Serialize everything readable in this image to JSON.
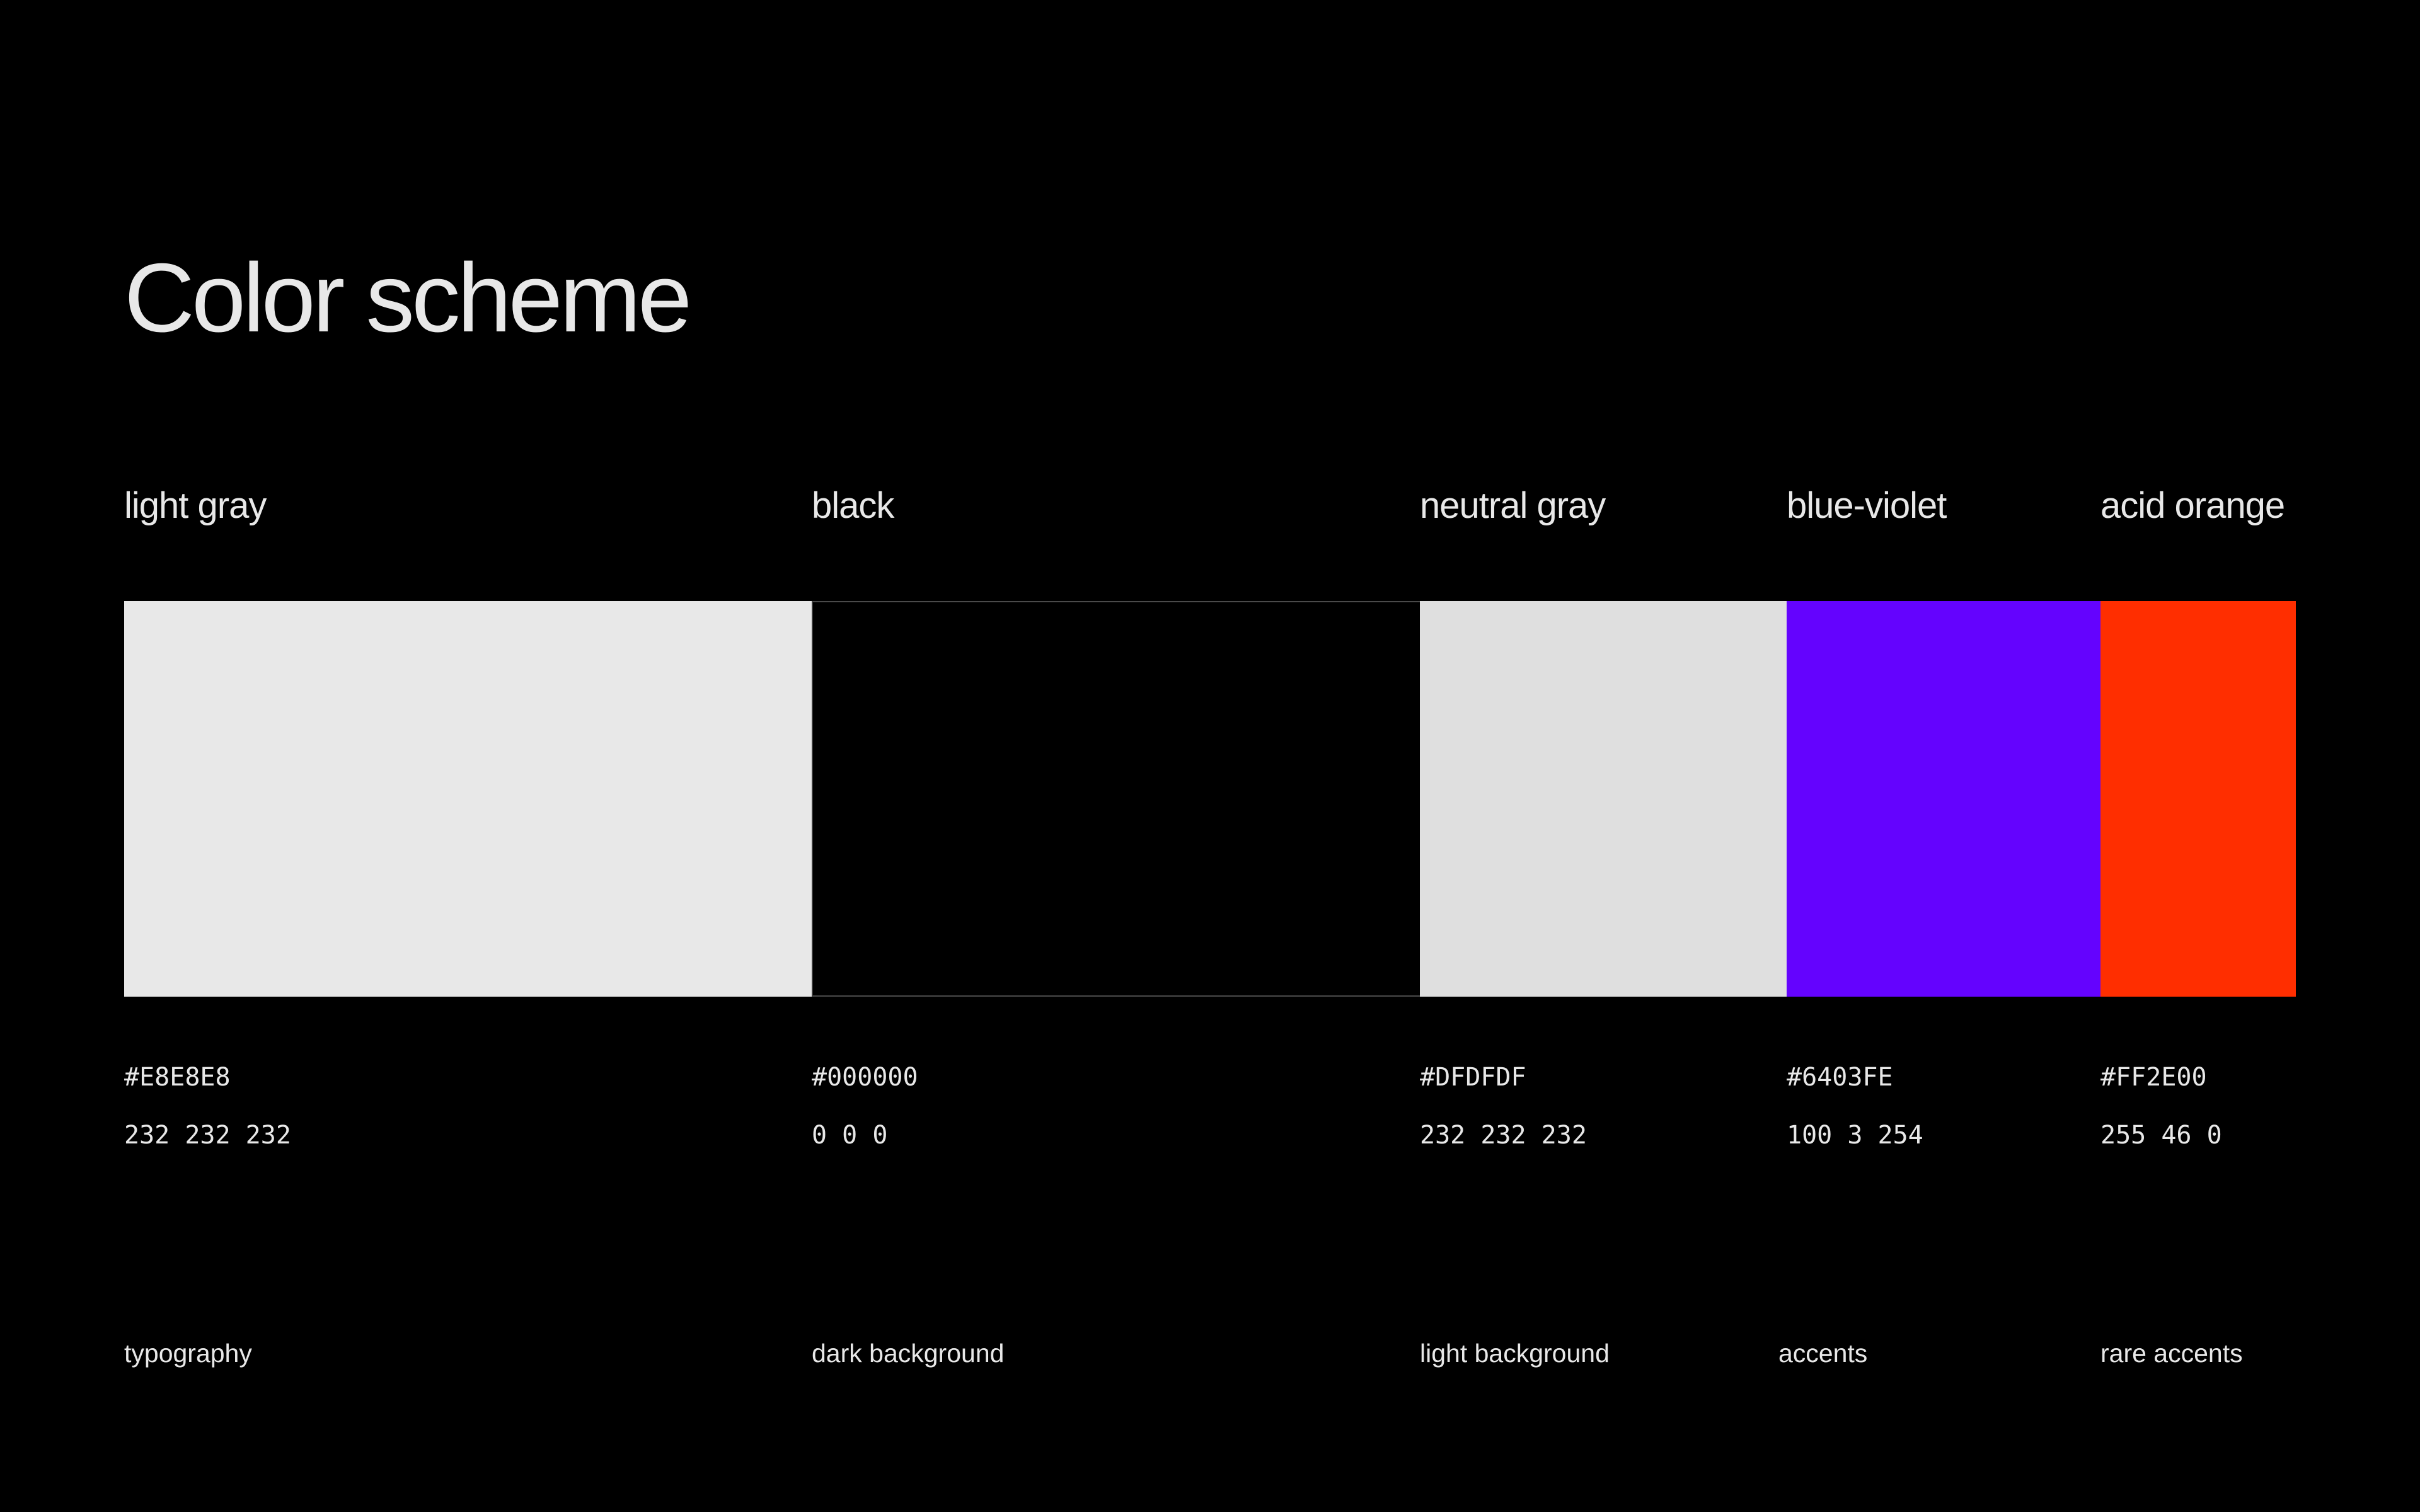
{
  "title": "Color scheme",
  "colors": [
    {
      "name": "light gray",
      "hex": "#E8E8E8",
      "rgb": "232 232 232",
      "usage": "typography",
      "swatch_color": "#E8E8E8"
    },
    {
      "name": "black",
      "hex": "#000000",
      "rgb": "0 0 0",
      "usage": "dark background",
      "swatch_color": "#000000"
    },
    {
      "name": "neutral gray",
      "hex": "#DFDFDF",
      "rgb": "232 232 232",
      "usage": "light background",
      "swatch_color": "#DFDFDF"
    },
    {
      "name": "blue-violet",
      "hex": "#6403FE",
      "rgb": "100 3 254",
      "usage": "accents",
      "swatch_color": "#6403FE"
    },
    {
      "name": "acid orange",
      "hex": "#FF2E00",
      "rgb": "255 46 0",
      "usage": "rare accents",
      "swatch_color": "#FF2E00"
    }
  ]
}
